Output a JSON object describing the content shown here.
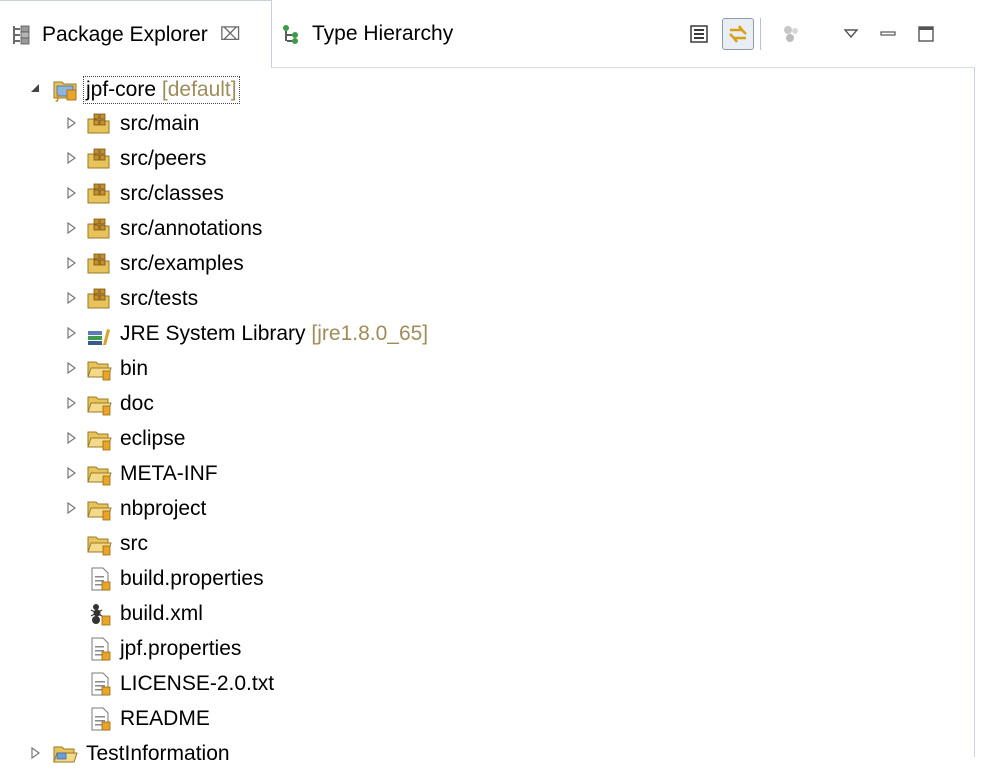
{
  "tabs": [
    {
      "label": "Package Explorer",
      "close": "⌧",
      "active": true
    },
    {
      "label": "Type Hierarchy",
      "active": false
    }
  ],
  "toolbar": {
    "collapse_all": "collapse-all",
    "link_with_editor": "link-with-editor",
    "focus": "focus-on-active-task",
    "view_menu": "view-menu",
    "minimize": "minimize",
    "maximize": "maximize"
  },
  "tree": {
    "project": {
      "label": "jpf-core",
      "decoration": "[default]"
    },
    "source_folders": [
      {
        "label": "src/main"
      },
      {
        "label": "src/peers"
      },
      {
        "label": "src/classes"
      },
      {
        "label": "src/annotations"
      },
      {
        "label": "src/examples"
      },
      {
        "label": "src/tests"
      }
    ],
    "library": {
      "label": "JRE System Library",
      "decoration": "[jre1.8.0_65]"
    },
    "folders": [
      {
        "label": "bin"
      },
      {
        "label": "doc"
      },
      {
        "label": "eclipse"
      },
      {
        "label": "META-INF"
      },
      {
        "label": "nbproject"
      }
    ],
    "src_folder": {
      "label": "src"
    },
    "files": [
      {
        "label": "build.properties",
        "icon": "properties-file-icon"
      },
      {
        "label": "build.xml",
        "icon": "ant-file-icon"
      },
      {
        "label": "jpf.properties",
        "icon": "properties-file-icon"
      },
      {
        "label": "LICENSE-2.0.txt",
        "icon": "text-file-icon"
      },
      {
        "label": "README",
        "icon": "text-file-icon"
      }
    ],
    "other_project": {
      "label": "TestInformation"
    }
  },
  "colors": {
    "decoration": "#a08c5a",
    "folder": "#e8c25a",
    "package_root": "#c58f2e",
    "accent": "#3b6ea5"
  }
}
